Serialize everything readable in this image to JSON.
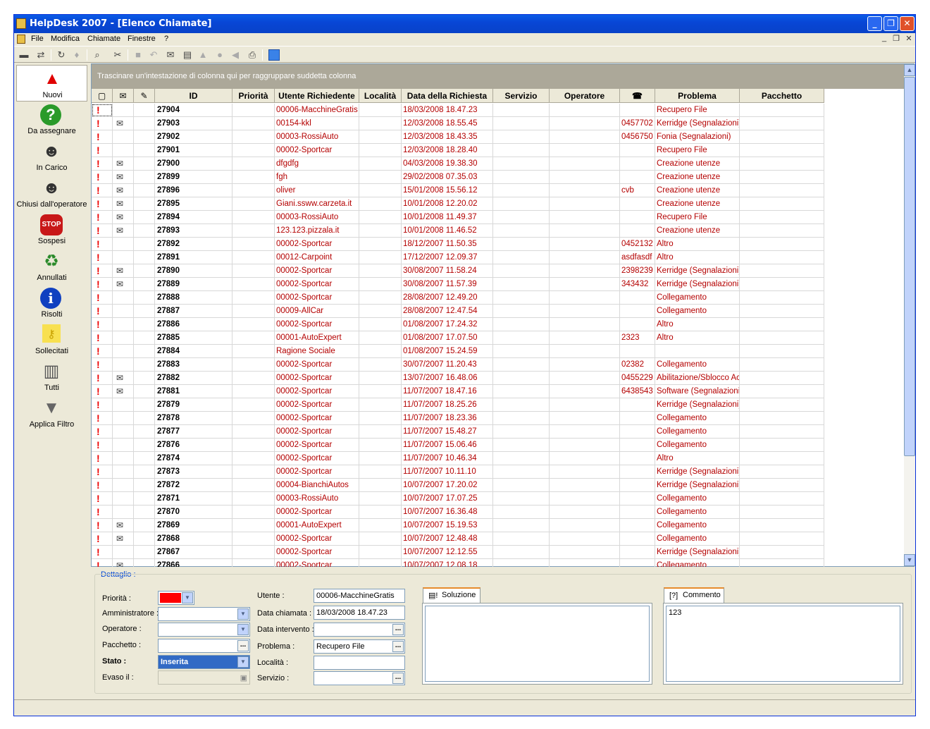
{
  "window": {
    "title": "HelpDesk 2007 - [Elenco Chiamate]",
    "controls": [
      "_",
      "❐",
      "✕"
    ]
  },
  "menu": [
    "File",
    "Modifica",
    "Chiamate",
    "Finestre",
    "?"
  ],
  "mdi_controls": [
    "_",
    "❐",
    "✕"
  ],
  "sidebar": [
    {
      "label": "Nuovi",
      "icon": "warning-icon"
    },
    {
      "label": "Da assegnare",
      "icon": "question-icon"
    },
    {
      "label": "In Carico",
      "icon": "user-icon"
    },
    {
      "label": "Chiusi dall'operatore",
      "icon": "user-lock-icon"
    },
    {
      "label": "Sospesi",
      "icon": "stop-icon"
    },
    {
      "label": "Annullati",
      "icon": "recycle-bin-icon"
    },
    {
      "label": "Risolti",
      "icon": "info-icon"
    },
    {
      "label": "Sollecitati",
      "icon": "note-key-icon"
    },
    {
      "label": "Tutti",
      "icon": "cabinet-icon"
    },
    {
      "label": "Applica Filtro",
      "icon": "funnel-icon"
    }
  ],
  "grid": {
    "group_hint": "Trascinare un'intestazione di colonna qui per raggruppare suddetta colonna",
    "columns": [
      "",
      "",
      "",
      "ID",
      "Priorità",
      "Utente Richiedente",
      "Località",
      "Data della Richiesta",
      "Servizio",
      "Operatore",
      "☎",
      "Problema",
      "Pacchetto"
    ],
    "rows": [
      {
        "env": false,
        "id": "27904",
        "utente": "00006-MacchineGratis",
        "data": "18/03/2008 18.47.23",
        "tel": "",
        "problema": "Recupero File"
      },
      {
        "env": true,
        "id": "27903",
        "utente": "00154-kkl",
        "data": "12/03/2008 18.55.45",
        "tel": "0457702",
        "problema": "Kerridge (Segnalazioni)"
      },
      {
        "env": false,
        "id": "27902",
        "utente": "00003-RossiAuto",
        "data": "12/03/2008 18.43.35",
        "tel": "0456750",
        "problema": "Fonia (Segnalazioni)"
      },
      {
        "env": false,
        "id": "27901",
        "utente": "00002-Sportcar",
        "data": "12/03/2008 18.28.40",
        "tel": "",
        "problema": "Recupero File"
      },
      {
        "env": true,
        "id": "27900",
        "utente": "dfgdfg",
        "data": "04/03/2008 19.38.30",
        "tel": "",
        "problema": "Creazione utenze"
      },
      {
        "env": true,
        "id": "27899",
        "utente": "fgh",
        "data": "29/02/2008 07.35.03",
        "tel": "",
        "problema": "Creazione utenze"
      },
      {
        "env": true,
        "id": "27896",
        "utente": "oliver",
        "data": "15/01/2008 15.56.12",
        "tel": "cvb",
        "problema": "Creazione utenze"
      },
      {
        "env": true,
        "id": "27895",
        "utente": "Giani.ssww.carzeta.it",
        "data": "10/01/2008 12.20.02",
        "tel": "",
        "problema": "Creazione utenze"
      },
      {
        "env": true,
        "id": "27894",
        "utente": "00003-RossiAuto",
        "data": "10/01/2008 11.49.37",
        "tel": "",
        "problema": "Recupero File"
      },
      {
        "env": true,
        "id": "27893",
        "utente": "123.123.pizzala.it",
        "data": "10/01/2008 11.46.52",
        "tel": "",
        "problema": "Creazione utenze"
      },
      {
        "env": false,
        "id": "27892",
        "utente": "00002-Sportcar",
        "data": "18/12/2007 11.50.35",
        "tel": "0452132",
        "problema": "Altro"
      },
      {
        "env": false,
        "id": "27891",
        "utente": "00012-Carpoint",
        "data": "17/12/2007 12.09.37",
        "tel": "asdfasdf",
        "problema": "Altro"
      },
      {
        "env": true,
        "id": "27890",
        "utente": "00002-Sportcar",
        "data": "30/08/2007 11.58.24",
        "tel": "2398239",
        "problema": "Kerridge (Segnalazioni)"
      },
      {
        "env": true,
        "id": "27889",
        "utente": "00002-Sportcar",
        "data": "30/08/2007 11.57.39",
        "tel": "343432",
        "problema": "Kerridge (Segnalazioni)"
      },
      {
        "env": false,
        "id": "27888",
        "utente": "00002-Sportcar",
        "data": "28/08/2007 12.49.20",
        "tel": "",
        "problema": "Collegamento"
      },
      {
        "env": false,
        "id": "27887",
        "utente": "00009-AllCar",
        "data": "28/08/2007 12.47.54",
        "tel": "",
        "problema": "Collegamento"
      },
      {
        "env": false,
        "id": "27886",
        "utente": "00002-Sportcar",
        "data": "01/08/2007 17.24.32",
        "tel": "",
        "problema": "Altro"
      },
      {
        "env": false,
        "id": "27885",
        "utente": "00001-AutoExpert",
        "data": "01/08/2007 17.07.50",
        "tel": "2323",
        "problema": "Altro"
      },
      {
        "env": false,
        "id": "27884",
        "utente": "Ragione Sociale",
        "data": "01/08/2007 15.24.59",
        "tel": "",
        "problema": ""
      },
      {
        "env": false,
        "id": "27883",
        "utente": "00002-Sportcar",
        "data": "30/07/2007 11.20.43",
        "tel": "02382",
        "problema": "Collegamento"
      },
      {
        "env": true,
        "id": "27882",
        "utente": "00002-Sportcar",
        "data": "13/07/2007 16.48.06",
        "tel": "0455229",
        "problema": "Abilitazione/Sblocco Ac"
      },
      {
        "env": true,
        "id": "27881",
        "utente": "00002-Sportcar",
        "data": "11/07/2007 18.47.16",
        "tel": "6438543",
        "problema": "Software (Segnalazioni)"
      },
      {
        "env": false,
        "id": "27879",
        "utente": "00002-Sportcar",
        "data": "11/07/2007 18.25.26",
        "tel": "",
        "problema": "Kerridge (Segnalazioni)"
      },
      {
        "env": false,
        "id": "27878",
        "utente": "00002-Sportcar",
        "data": "11/07/2007 18.23.36",
        "tel": "",
        "problema": "Collegamento"
      },
      {
        "env": false,
        "id": "27877",
        "utente": "00002-Sportcar",
        "data": "11/07/2007 15.48.27",
        "tel": "",
        "problema": "Collegamento"
      },
      {
        "env": false,
        "id": "27876",
        "utente": "00002-Sportcar",
        "data": "11/07/2007 15.06.46",
        "tel": "",
        "problema": "Collegamento"
      },
      {
        "env": false,
        "id": "27874",
        "utente": "00002-Sportcar",
        "data": "11/07/2007 10.46.34",
        "tel": "",
        "problema": "Altro"
      },
      {
        "env": false,
        "id": "27873",
        "utente": "00002-Sportcar",
        "data": "11/07/2007 10.11.10",
        "tel": "",
        "problema": "Kerridge (Segnalazioni)"
      },
      {
        "env": false,
        "id": "27872",
        "utente": "00004-BianchiAutos",
        "data": "10/07/2007 17.20.02",
        "tel": "",
        "problema": "Kerridge (Segnalazioni)"
      },
      {
        "env": false,
        "id": "27871",
        "utente": "00003-RossiAuto",
        "data": "10/07/2007 17.07.25",
        "tel": "",
        "problema": "Collegamento"
      },
      {
        "env": false,
        "id": "27870",
        "utente": "00002-Sportcar",
        "data": "10/07/2007 16.36.48",
        "tel": "",
        "problema": "Collegamento"
      },
      {
        "env": true,
        "id": "27869",
        "utente": "00001-AutoExpert",
        "data": "10/07/2007 15.19.53",
        "tel": "",
        "problema": "Collegamento"
      },
      {
        "env": true,
        "id": "27868",
        "utente": "00002-Sportcar",
        "data": "10/07/2007 12.48.48",
        "tel": "",
        "problema": "Collegamento"
      },
      {
        "env": false,
        "id": "27867",
        "utente": "00002-Sportcar",
        "data": "10/07/2007 12.12.55",
        "tel": "",
        "problema": "Kerridge (Segnalazioni)"
      },
      {
        "env": true,
        "id": "27866",
        "utente": "00002-Sportcar",
        "data": "10/07/2007 12.08.18",
        "tel": "",
        "problema": "Collegamento"
      }
    ]
  },
  "detail": {
    "title": "Dettaglio :",
    "priorita_label": "Priorità :",
    "priorita_color": "#ff0000",
    "amministratore_label": "Amministratore :",
    "operatore_label": "Operatore :",
    "pacchetto_label": "Pacchetto :",
    "stato_label": "Stato :",
    "stato_value": "Inserita",
    "evaso_label": "Evaso il :",
    "utente_label": "Utente :",
    "utente_value": "00006-MacchineGratis",
    "data_chiamata_label": "Data chiamata :",
    "data_chiamata_value": "18/03/2008 18.47.23",
    "data_intervento_label": "Data intervento :",
    "problema_label": "Problema :",
    "problema_value": "Recupero File",
    "localita_label": "Località :",
    "servizio_label": "Servizio :",
    "soluzione_tab": "Soluzione",
    "commento_tab": "Commento",
    "commento_value": "123",
    "ellipsis": "..."
  }
}
